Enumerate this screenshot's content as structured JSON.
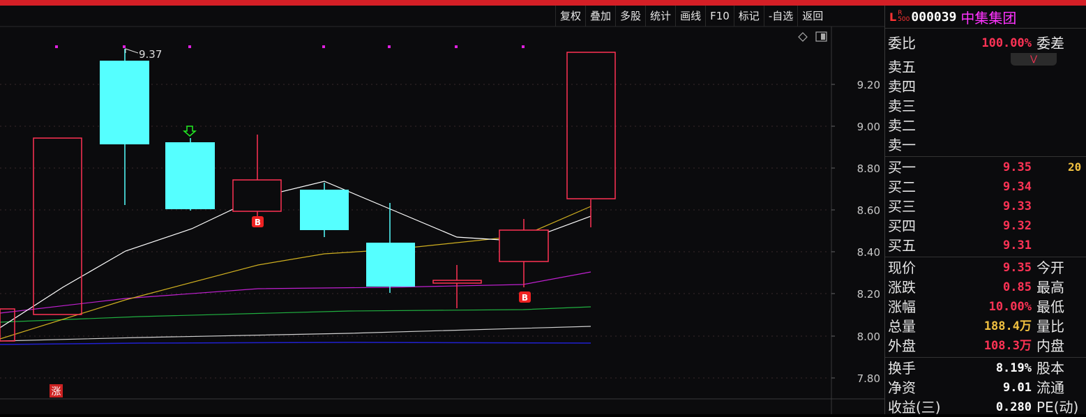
{
  "toolbar": {
    "buttons": [
      "复权",
      "叠加",
      "多股",
      "统计",
      "画线",
      "F10",
      "标记",
      "-自选",
      "返回"
    ]
  },
  "chart": {
    "high_label": "9.37",
    "zhang_badge": "涨",
    "b_marker": "B",
    "y_ticks": [
      "9.20",
      "9.00",
      "8.80",
      "8.60",
      "8.40",
      "8.20",
      "8.00",
      "7.80"
    ]
  },
  "stock": {
    "logo": "L",
    "logo_sup_top": "R",
    "logo_sup_bottom": "500",
    "code": "000039",
    "name": "中集集团"
  },
  "quote": {
    "weibi_label": "委比",
    "weibi_value": "100.00%",
    "weicha_label": "委差",
    "sell_labels": [
      "卖五",
      "卖四",
      "卖三",
      "卖二",
      "卖一"
    ],
    "buy_labels": [
      "买一",
      "买二",
      "买三",
      "买四",
      "买五"
    ],
    "buy_prices": [
      "9.35",
      "9.34",
      "9.33",
      "9.32",
      "9.31"
    ],
    "buy1_volume": "20",
    "stats": [
      {
        "label": "现价",
        "value": "9.35",
        "label2": "今开"
      },
      {
        "label": "涨跌",
        "value": "0.85",
        "label2": "最高"
      },
      {
        "label": "涨幅",
        "value": "10.00%",
        "label2": "最低"
      },
      {
        "label": "总量",
        "value": "188.4万",
        "label2": "量比"
      },
      {
        "label": "外盘",
        "value": "108.3万",
        "label2": "内盘"
      }
    ],
    "stats2": [
      {
        "label": "换手",
        "value": "8.19%",
        "label2": "股本"
      },
      {
        "label": "净资",
        "value": "9.01",
        "label2": "流通"
      },
      {
        "label": "收益(三)",
        "value": "0.280",
        "label2": "PE(动)"
      }
    ]
  }
}
